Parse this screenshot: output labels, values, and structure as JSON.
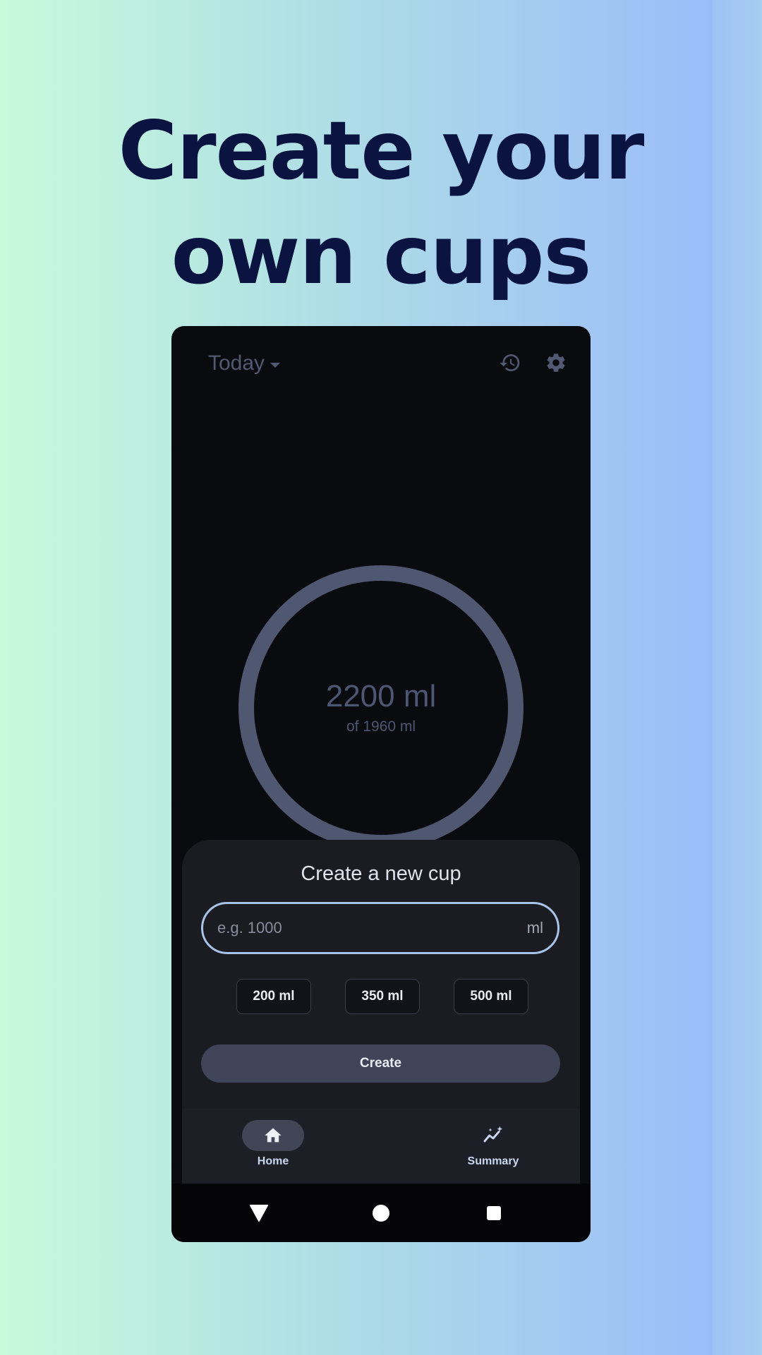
{
  "promo": {
    "headline_line1": "Create your",
    "headline_line2": "own cups"
  },
  "topbar": {
    "date_label": "Today",
    "icons": [
      "chevron-down-icon",
      "history-icon",
      "settings-gear-icon"
    ]
  },
  "progress": {
    "amount": "2200 ml",
    "goal": "of 1960 ml"
  },
  "sheet": {
    "title": "Create a new cup",
    "input_placeholder": "e.g. 1000",
    "input_unit": "ml",
    "presets": [
      "200 ml",
      "350 ml",
      "500 ml"
    ],
    "create_label": "Create"
  },
  "bottom_nav": {
    "items": [
      {
        "label": "Home",
        "icon": "home-icon",
        "selected": true
      },
      {
        "label": "Summary",
        "icon": "summary-chart-icon",
        "selected": false
      }
    ]
  },
  "system_nav": {
    "icons": [
      "back-triangle-icon",
      "home-circle-icon",
      "recents-square-icon"
    ]
  },
  "colors": {
    "headline": "#0b1340",
    "phone_bg": "#0a0b0e",
    "ring": "#4f5771",
    "sheet_bg": "#1a1c22",
    "field_outline": "#a8c3e8",
    "button_bg": "#3f4458"
  }
}
